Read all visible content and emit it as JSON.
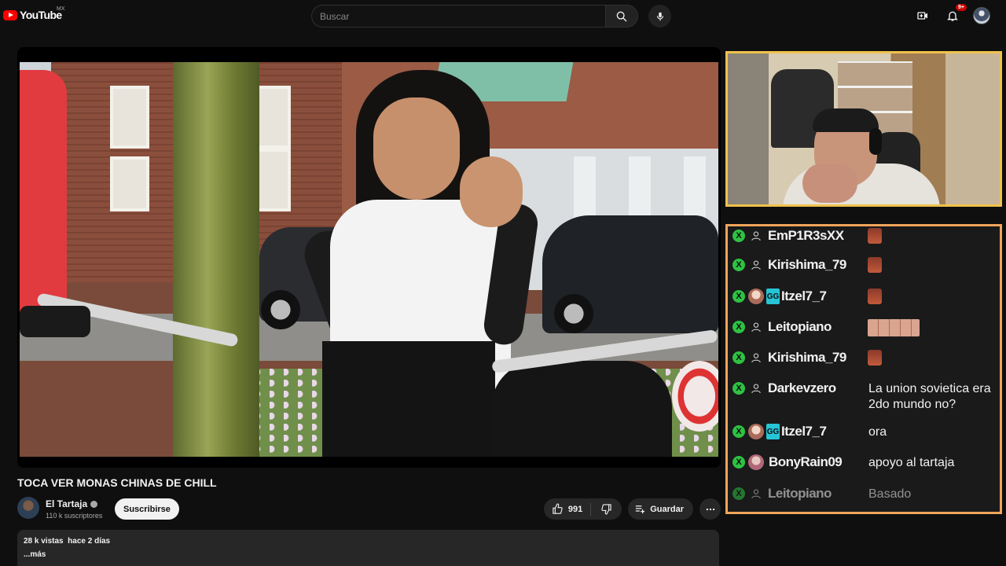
{
  "header": {
    "logo_text": "YouTube",
    "region": "MX",
    "search_placeholder": "Buscar",
    "notification_count": "9+",
    "icons": [
      "search-icon",
      "mic-icon",
      "create-video-icon",
      "bell-icon",
      "account-avatar"
    ]
  },
  "video": {
    "title": "TOCA VER MONAS CHINAS DE CHILL",
    "channel_name": "El Tartaja",
    "subscribers": "110 k suscriptores",
    "subscribe_label": "Suscribirse",
    "likes": "991",
    "save_label": "Guardar",
    "views": "28 k vistas",
    "uploaded": "hace 2 días",
    "more_label": "...más"
  },
  "chat": {
    "messages": [
      {
        "user": "EmP1R3sXX",
        "text": "",
        "emote": "single",
        "avatar": "person-icon"
      },
      {
        "user": "Kirishima_79",
        "text": "",
        "emote": "single",
        "avatar": "person-icon"
      },
      {
        "user": "Itzel7_7",
        "text": "",
        "emote": "single",
        "avatar": "photo",
        "badge": "GG"
      },
      {
        "user": "Leitopiano",
        "text": "",
        "emote": "strip",
        "avatar": "person-icon"
      },
      {
        "user": "Kirishima_79",
        "text": "",
        "emote": "single",
        "avatar": "person-icon"
      },
      {
        "user": "Darkevzero",
        "text": "La union sovietica era 2do mundo no?",
        "avatar": "person-icon"
      },
      {
        "user": "Itzel7_7",
        "text": "ora",
        "avatar": "photo",
        "badge": "GG"
      },
      {
        "user": "BonyRain09",
        "text": "apoyo al tartaja",
        "avatar": "photo"
      },
      {
        "user": "Leitopiano",
        "text": "Basado",
        "avatar": "person-icon"
      }
    ],
    "badge_letter": "X",
    "colors": {
      "badge": "#2ec243",
      "border": "#f0a55a",
      "webcam_border": "#f0c24c"
    }
  }
}
